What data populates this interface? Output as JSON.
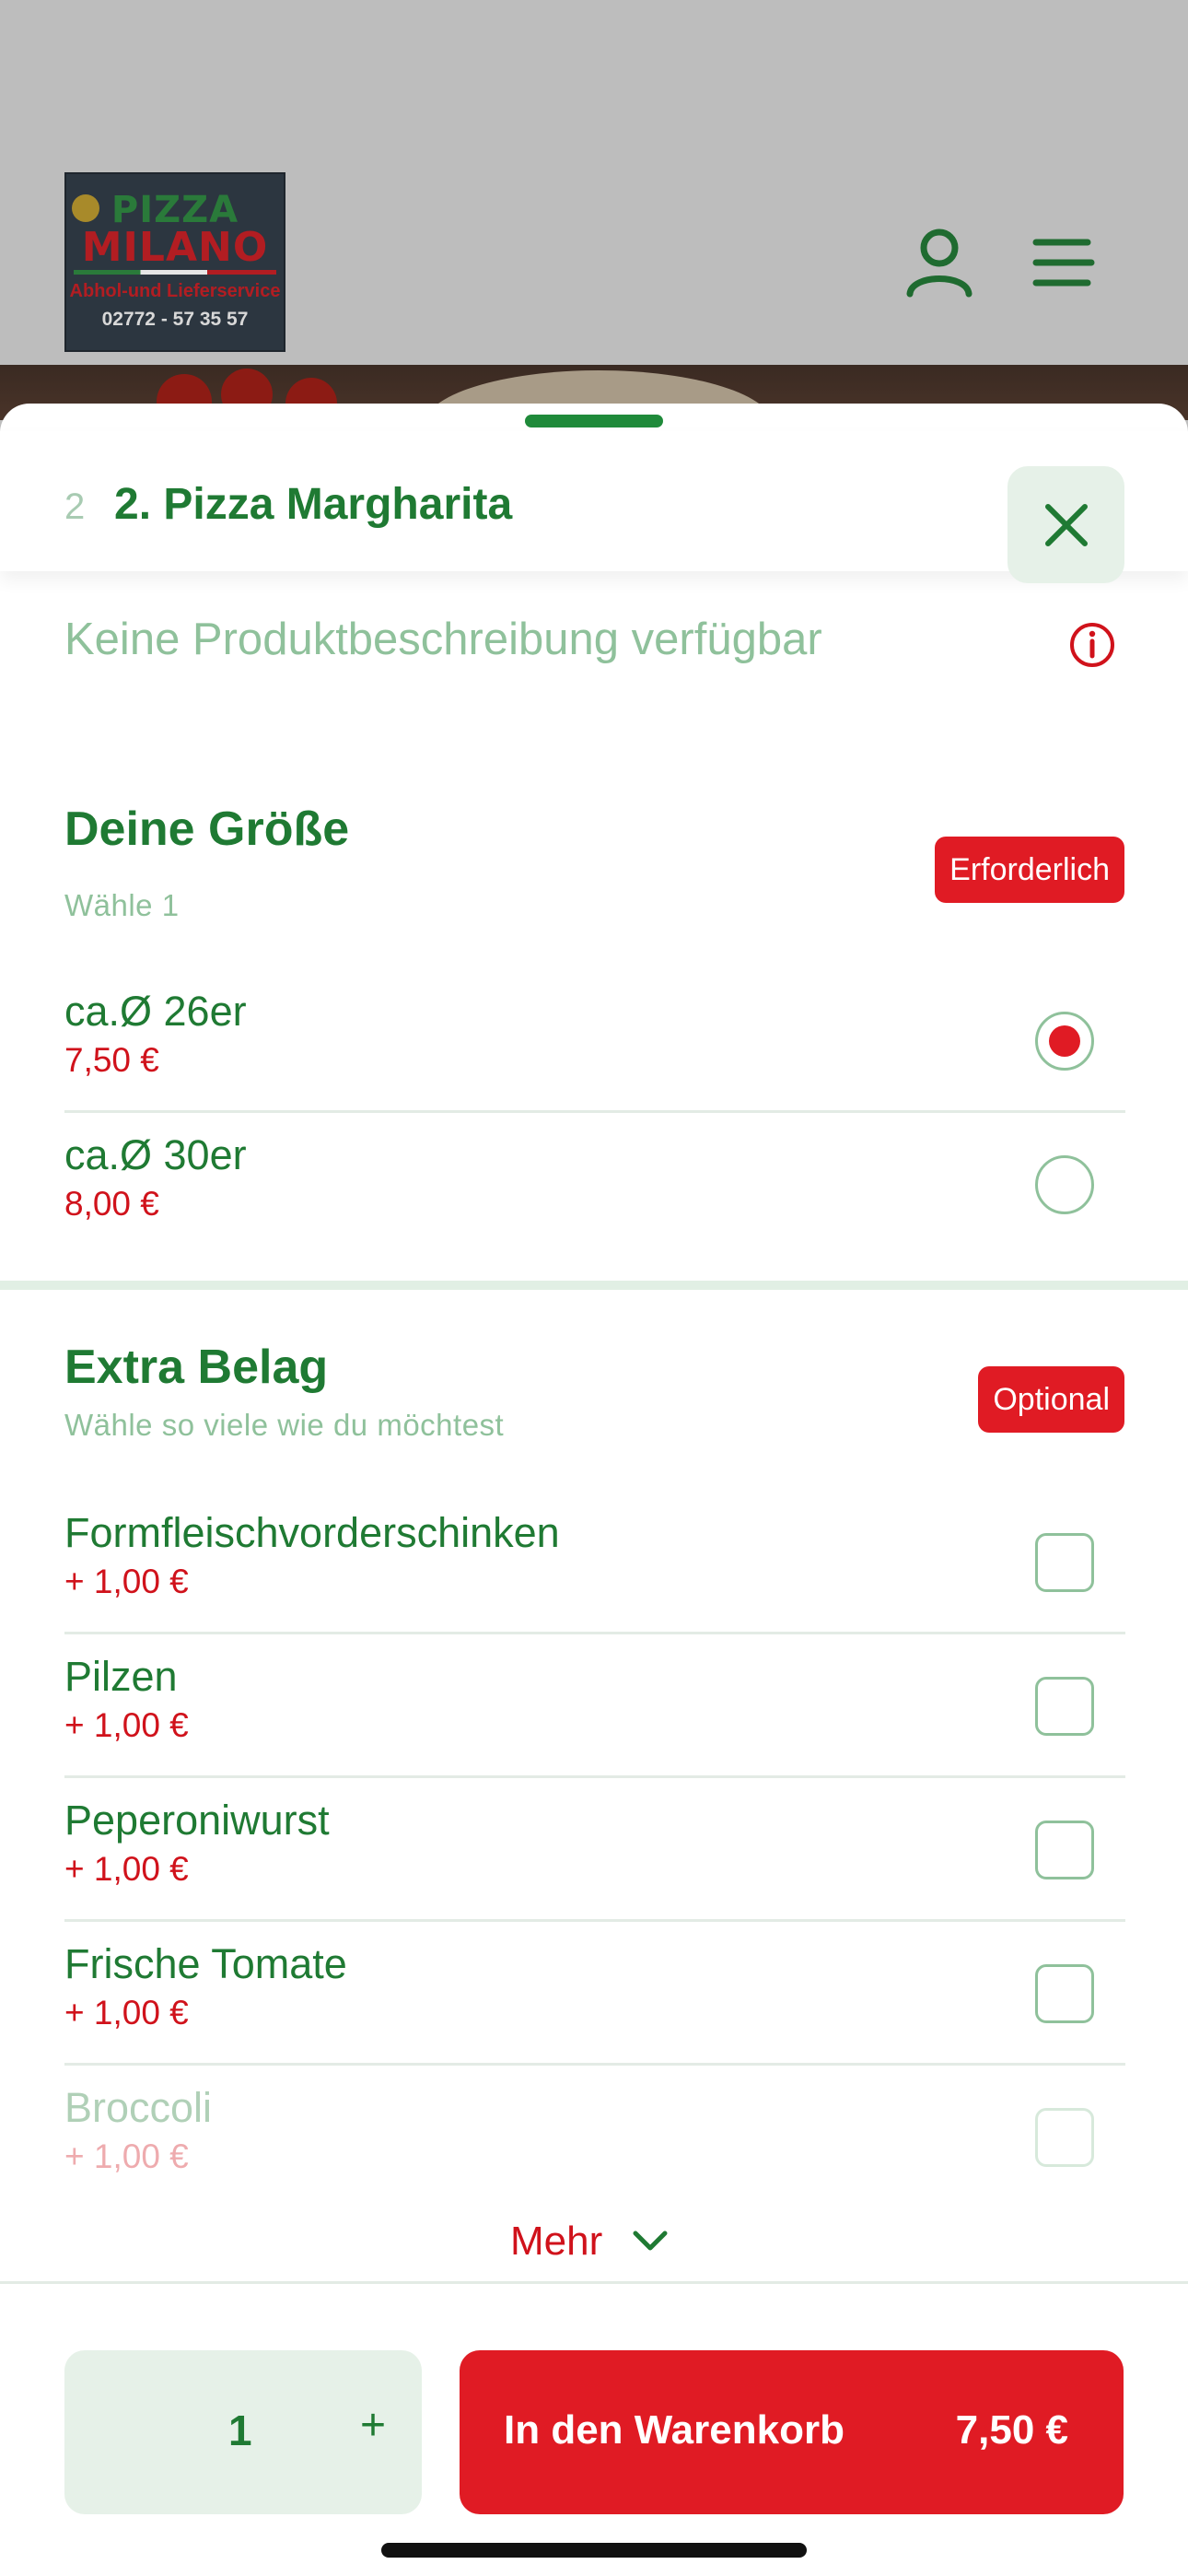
{
  "header": {
    "logo": {
      "line1": "PIZZA",
      "line2": "MILANO",
      "line3": "Abhol-und Lieferservice",
      "phone": "02772 - 57 35 57"
    },
    "user_icon": "user-icon",
    "menu_icon": "menu-icon"
  },
  "sheet": {
    "item_number": "2",
    "item_title": "2. Pizza Margharita",
    "close_icon": "close-icon",
    "description": "Keine Produktbeschreibung verfügbar",
    "info_icon": "info-icon"
  },
  "size_section": {
    "title": "Deine Größe",
    "subtitle": "Wähle 1",
    "tag": "Erforderlich",
    "options": [
      {
        "name": "ca.Ø 26er",
        "price": "7,50 €",
        "selected": true
      },
      {
        "name": "ca.Ø 30er",
        "price": "8,00 €",
        "selected": false
      }
    ]
  },
  "extra_section": {
    "title": "Extra Belag",
    "subtitle": "Wähle so viele wie du möchtest",
    "tag": "Optional",
    "options": [
      {
        "name": "Formfleischvorderschinken",
        "price": "+ 1,00 €"
      },
      {
        "name": "Pilzen",
        "price": "+ 1,00 €"
      },
      {
        "name": "Peperoniwurst",
        "price": "+ 1,00 €"
      },
      {
        "name": "Frische Tomate",
        "price": "+ 1,00 €"
      },
      {
        "name": "Broccoli",
        "price": "+ 1,00 €"
      }
    ],
    "more_label": "Mehr"
  },
  "footer": {
    "quantity": "1",
    "plus_label": "+",
    "cart_label": "In den Warenkorb",
    "cart_amount": "7,50 €"
  },
  "colors": {
    "brand_green": "#1f7a33",
    "accent_red": "#e01b24",
    "muted_green": "#8fc19b"
  }
}
